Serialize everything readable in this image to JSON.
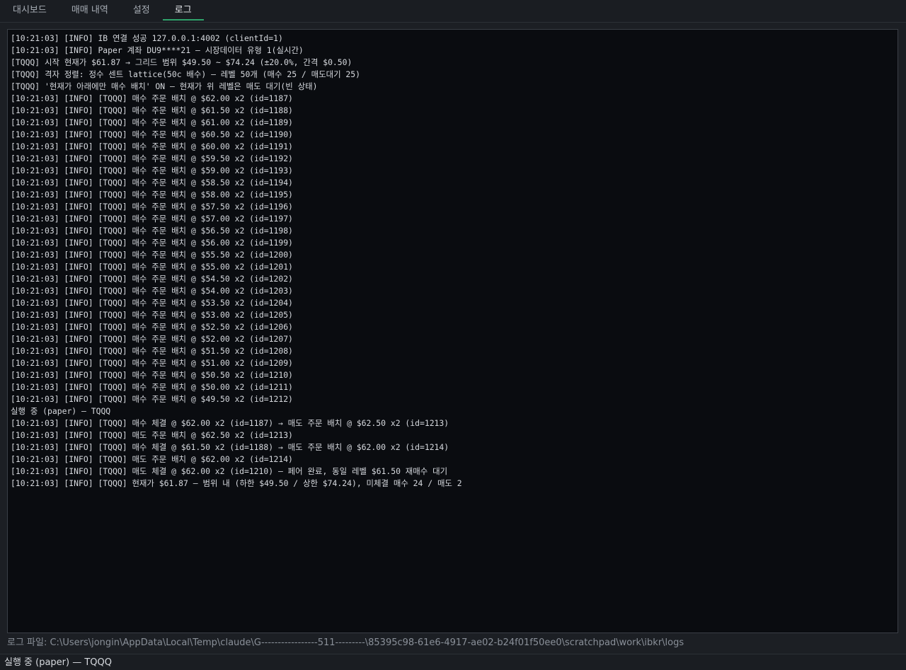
{
  "tabs": [
    {
      "label": "대시보드",
      "active": false
    },
    {
      "label": "매매 내역",
      "active": false
    },
    {
      "label": "설정",
      "active": false
    },
    {
      "label": "로그",
      "active": true
    }
  ],
  "log_lines": [
    "[10:21:03] [INFO] IB 연결 성공 127.0.0.1:4002 (clientId=1)",
    "[10:21:03] [INFO] Paper 계좌 DU9****21 — 시장데이터 유형 1(실시간)",
    "[TQQQ] 시작 현재가 $61.87 → 그리드 범위 $49.50 ~ $74.24 (±20.0%, 간격 $0.50)",
    "[TQQQ] 격자 정렬: 정수 센트 lattice(50c 배수) — 레벨 50개 (매수 25 / 매도대기 25)",
    "[TQQQ] '현재가 아래에만 매수 배치' ON — 현재가 위 레벨은 매도 대기(빈 상태)",
    "[10:21:03] [INFO] [TQQQ] 매수 주문 배치 @ $62.00 x2 (id=1187)",
    "[10:21:03] [INFO] [TQQQ] 매수 주문 배치 @ $61.50 x2 (id=1188)",
    "[10:21:03] [INFO] [TQQQ] 매수 주문 배치 @ $61.00 x2 (id=1189)",
    "[10:21:03] [INFO] [TQQQ] 매수 주문 배치 @ $60.50 x2 (id=1190)",
    "[10:21:03] [INFO] [TQQQ] 매수 주문 배치 @ $60.00 x2 (id=1191)",
    "[10:21:03] [INFO] [TQQQ] 매수 주문 배치 @ $59.50 x2 (id=1192)",
    "[10:21:03] [INFO] [TQQQ] 매수 주문 배치 @ $59.00 x2 (id=1193)",
    "[10:21:03] [INFO] [TQQQ] 매수 주문 배치 @ $58.50 x2 (id=1194)",
    "[10:21:03] [INFO] [TQQQ] 매수 주문 배치 @ $58.00 x2 (id=1195)",
    "[10:21:03] [INFO] [TQQQ] 매수 주문 배치 @ $57.50 x2 (id=1196)",
    "[10:21:03] [INFO] [TQQQ] 매수 주문 배치 @ $57.00 x2 (id=1197)",
    "[10:21:03] [INFO] [TQQQ] 매수 주문 배치 @ $56.50 x2 (id=1198)",
    "[10:21:03] [INFO] [TQQQ] 매수 주문 배치 @ $56.00 x2 (id=1199)",
    "[10:21:03] [INFO] [TQQQ] 매수 주문 배치 @ $55.50 x2 (id=1200)",
    "[10:21:03] [INFO] [TQQQ] 매수 주문 배치 @ $55.00 x2 (id=1201)",
    "[10:21:03] [INFO] [TQQQ] 매수 주문 배치 @ $54.50 x2 (id=1202)",
    "[10:21:03] [INFO] [TQQQ] 매수 주문 배치 @ $54.00 x2 (id=1203)",
    "[10:21:03] [INFO] [TQQQ] 매수 주문 배치 @ $53.50 x2 (id=1204)",
    "[10:21:03] [INFO] [TQQQ] 매수 주문 배치 @ $53.00 x2 (id=1205)",
    "[10:21:03] [INFO] [TQQQ] 매수 주문 배치 @ $52.50 x2 (id=1206)",
    "[10:21:03] [INFO] [TQQQ] 매수 주문 배치 @ $52.00 x2 (id=1207)",
    "[10:21:03] [INFO] [TQQQ] 매수 주문 배치 @ $51.50 x2 (id=1208)",
    "[10:21:03] [INFO] [TQQQ] 매수 주문 배치 @ $51.00 x2 (id=1209)",
    "[10:21:03] [INFO] [TQQQ] 매수 주문 배치 @ $50.50 x2 (id=1210)",
    "[10:21:03] [INFO] [TQQQ] 매수 주문 배치 @ $50.00 x2 (id=1211)",
    "[10:21:03] [INFO] [TQQQ] 매수 주문 배치 @ $49.50 x2 (id=1212)",
    "실행 중 (paper) — TQQQ",
    "[10:21:03] [INFO] [TQQQ] 매수 체결 @ $62.00 x2 (id=1187) → 매도 주문 배치 @ $62.50 x2 (id=1213)",
    "[10:21:03] [INFO] [TQQQ] 매도 주문 배치 @ $62.50 x2 (id=1213)",
    "[10:21:03] [INFO] [TQQQ] 매수 체결 @ $61.50 x2 (id=1188) → 매도 주문 배치 @ $62.00 x2 (id=1214)",
    "[10:21:03] [INFO] [TQQQ] 매도 주문 배치 @ $62.00 x2 (id=1214)",
    "[10:21:03] [INFO] [TQQQ] 매도 체결 @ $62.00 x2 (id=1210) — 페어 완료, 동일 레벨 $61.50 재매수 대기",
    "[10:21:03] [INFO] [TQQQ] 현재가 $61.87 — 범위 내 (하한 $49.50 / 상한 $74.24), 미체결 매수 24 / 매도 2"
  ],
  "log_file": "로그 파일: C:\\Users\\jongin\\AppData\\Local\\Temp\\claude\\G-----------------511---------\\85395c98-61e6-4917-ae02-b24f01f50ee0\\scratchpad\\work\\ibkr\\logs",
  "status": "실행 중 (paper) — TQQQ"
}
